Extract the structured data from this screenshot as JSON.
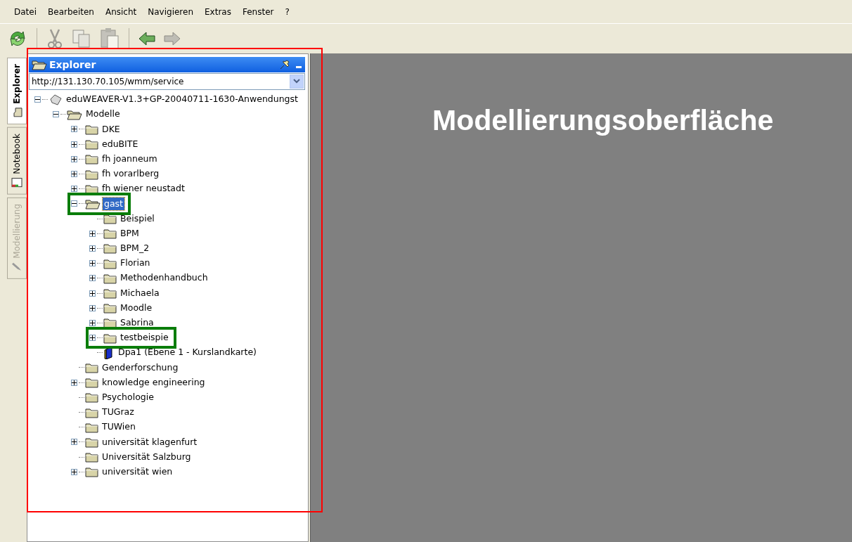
{
  "menu": [
    "Datei",
    "Bearbeiten",
    "Ansicht",
    "Navigieren",
    "Extras",
    "Fenster",
    "?"
  ],
  "toolbar": [
    {
      "buttons": [
        {
          "kind": "refresh",
          "disabled": false
        }
      ]
    },
    {
      "buttons": [
        {
          "kind": "cut",
          "disabled": true
        },
        {
          "kind": "copy",
          "disabled": true
        },
        {
          "kind": "paste",
          "disabled": true
        }
      ]
    },
    {
      "buttons": [
        {
          "kind": "back",
          "disabled": false
        },
        {
          "kind": "forward",
          "disabled": true
        }
      ]
    }
  ],
  "side_tabs": [
    {
      "label": "Explorer",
      "kind": "explorer",
      "selected": true,
      "disabled": false
    },
    {
      "label": "Notebook",
      "kind": "notebook",
      "selected": false,
      "disabled": false
    },
    {
      "label": "Modellierung",
      "kind": "pencil",
      "selected": false,
      "disabled": true
    }
  ],
  "explorer": {
    "title": "Explorer",
    "url": "http://131.130.70.105/wmm/service",
    "tree": [
      {
        "label": "eduWEAVER-V1.3+GP-20040711-1630-Anwendungst",
        "kind": "root",
        "has_children": true,
        "expanded": true,
        "selected": false,
        "highlighted": false,
        "children": [
          {
            "label": "Modelle",
            "kind": "folder",
            "has_children": true,
            "expanded": true,
            "selected": false,
            "highlighted": false,
            "children": [
              {
                "label": "DKE",
                "kind": "folder",
                "has_children": true,
                "expanded": false,
                "selected": false,
                "highlighted": false
              },
              {
                "label": "eduBITE",
                "kind": "folder",
                "has_children": true,
                "expanded": false,
                "selected": false,
                "highlighted": false
              },
              {
                "label": "fh joanneum",
                "kind": "folder",
                "has_children": true,
                "expanded": false,
                "selected": false,
                "highlighted": false
              },
              {
                "label": "fh vorarlberg",
                "kind": "folder",
                "has_children": true,
                "expanded": false,
                "selected": false,
                "highlighted": false
              },
              {
                "label": "fh wiener neustadt",
                "kind": "folder",
                "has_children": true,
                "expanded": false,
                "selected": false,
                "highlighted": false
              },
              {
                "label": "gast",
                "kind": "folder",
                "has_children": true,
                "expanded": true,
                "selected": true,
                "highlighted": true,
                "children": [
                  {
                    "label": "Beispiel",
                    "kind": "folder",
                    "has_children": false,
                    "expanded": false,
                    "selected": false,
                    "highlighted": false
                  },
                  {
                    "label": "BPM",
                    "kind": "folder",
                    "has_children": true,
                    "expanded": false,
                    "selected": false,
                    "highlighted": false
                  },
                  {
                    "label": "BPM_2",
                    "kind": "folder",
                    "has_children": true,
                    "expanded": false,
                    "selected": false,
                    "highlighted": false
                  },
                  {
                    "label": "Florian",
                    "kind": "folder",
                    "has_children": true,
                    "expanded": false,
                    "selected": false,
                    "highlighted": false
                  },
                  {
                    "label": "Methodenhandbuch",
                    "kind": "folder",
                    "has_children": true,
                    "expanded": false,
                    "selected": false,
                    "highlighted": false
                  },
                  {
                    "label": "Michaela",
                    "kind": "folder",
                    "has_children": true,
                    "expanded": false,
                    "selected": false,
                    "highlighted": false
                  },
                  {
                    "label": "Moodle",
                    "kind": "folder",
                    "has_children": true,
                    "expanded": false,
                    "selected": false,
                    "highlighted": false
                  },
                  {
                    "label": "Sabrina",
                    "kind": "folder",
                    "has_children": true,
                    "expanded": false,
                    "selected": false,
                    "highlighted": false
                  },
                  {
                    "label": "testbeispie",
                    "kind": "folder",
                    "has_children": true,
                    "expanded": false,
                    "selected": false,
                    "highlighted": true
                  },
                  {
                    "label": "Dpa1 (Ebene 1 - Kurslandkarte)",
                    "kind": "model",
                    "has_children": false,
                    "expanded": false,
                    "selected": false,
                    "highlighted": false
                  }
                ]
              },
              {
                "label": "Genderforschung",
                "kind": "folder",
                "has_children": false,
                "expanded": false,
                "selected": false,
                "highlighted": false
              },
              {
                "label": "knowledge engineering",
                "kind": "folder",
                "has_children": true,
                "expanded": false,
                "selected": false,
                "highlighted": false
              },
              {
                "label": "Psychologie",
                "kind": "folder",
                "has_children": false,
                "expanded": false,
                "selected": false,
                "highlighted": false
              },
              {
                "label": "TUGraz",
                "kind": "folder",
                "has_children": false,
                "expanded": false,
                "selected": false,
                "highlighted": false
              },
              {
                "label": "TUWien",
                "kind": "folder",
                "has_children": false,
                "expanded": false,
                "selected": false,
                "highlighted": false
              },
              {
                "label": "universität klagenfurt",
                "kind": "folder",
                "has_children": true,
                "expanded": false,
                "selected": false,
                "highlighted": false
              },
              {
                "label": "Universität Salzburg",
                "kind": "folder",
                "has_children": false,
                "expanded": false,
                "selected": false,
                "highlighted": false
              },
              {
                "label": "universität wien",
                "kind": "folder",
                "has_children": true,
                "expanded": false,
                "selected": false,
                "highlighted": false
              }
            ]
          }
        ]
      }
    ]
  },
  "canvas": {
    "title": "Modellierungsoberfläche"
  }
}
